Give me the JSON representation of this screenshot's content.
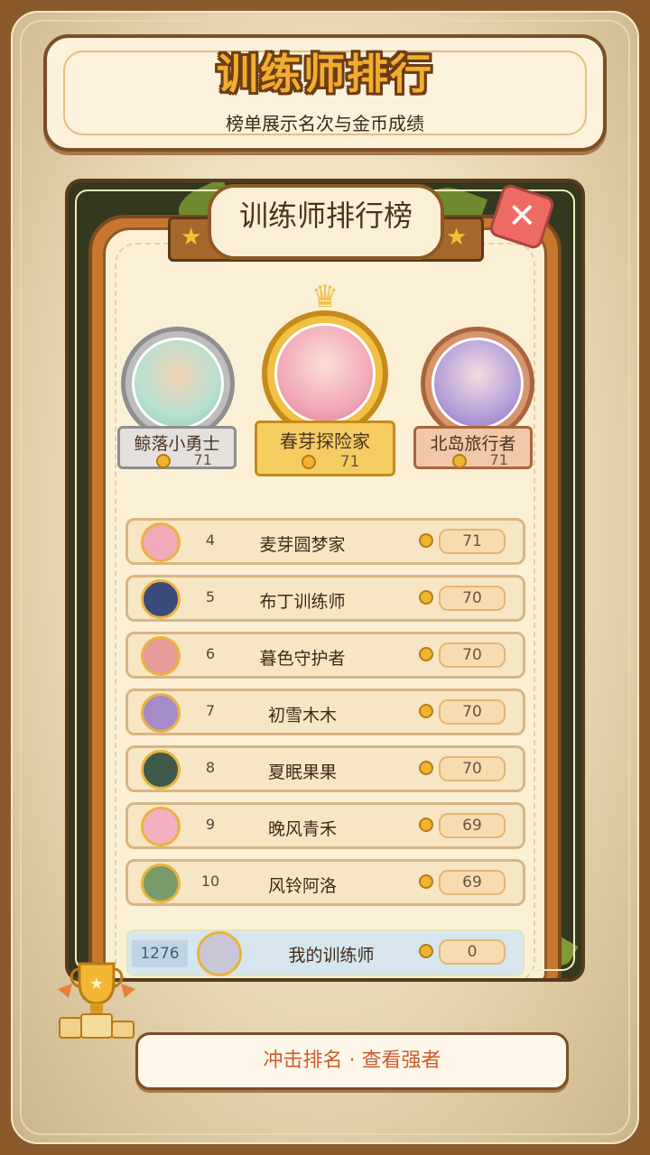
{
  "header": {
    "title": "训练师排行",
    "subtitle": "榜单展示名次与金币成绩"
  },
  "panel": {
    "title": "训练师排行榜",
    "close_icon": "close-x-icon"
  },
  "podium": [
    {
      "place": 2,
      "name": "鲸落小勇士",
      "score": "71",
      "medal": "silver",
      "color": "#c9c9c9"
    },
    {
      "place": 1,
      "name": "春芽探险家",
      "score": "71",
      "medal": "gold",
      "color": "#f2c044"
    },
    {
      "place": 3,
      "name": "北岛旅行者",
      "score": "71",
      "medal": "bronze",
      "color": "#d8946a"
    }
  ],
  "list": [
    {
      "rank": "4",
      "name": "麦芽圆梦家",
      "score": "71",
      "avatar_color": "#f2a9b8"
    },
    {
      "rank": "5",
      "name": "布丁训练师",
      "score": "70",
      "avatar_color": "#3b4a7a"
    },
    {
      "rank": "6",
      "name": "暮色守护者",
      "score": "70",
      "avatar_color": "#e69a9a"
    },
    {
      "rank": "7",
      "name": "初雪木木",
      "score": "70",
      "avatar_color": "#a68bc9"
    },
    {
      "rank": "8",
      "name": "夏眠果果",
      "score": "70",
      "avatar_color": "#3f5a4a"
    },
    {
      "rank": "9",
      "name": "晚风青禾",
      "score": "69",
      "avatar_color": "#f4b0c0"
    },
    {
      "rank": "10",
      "name": "风铃阿洛",
      "score": "69",
      "avatar_color": "#7a9a6a"
    }
  ],
  "me": {
    "rank": "1276",
    "name": "我的训练师",
    "score": "0",
    "avatar_color": "#c9c6d8"
  },
  "bottom_button": {
    "label": "冲击排名 · 查看强者"
  },
  "colors": {
    "accent": "#f2ad2f",
    "frame": "#8a5a2b",
    "button_text": "#cc5c2f"
  }
}
